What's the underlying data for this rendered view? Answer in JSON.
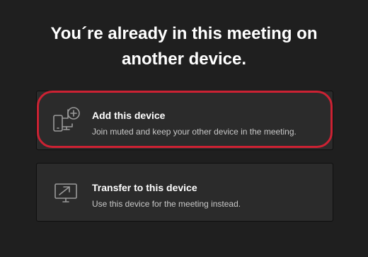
{
  "dialog": {
    "title_line1": "You´re already in this meeting on",
    "title_line2": "another device."
  },
  "options": [
    {
      "title": "Add this device",
      "description": "Join muted and keep your other device in the meeting.",
      "icon": "add-device-icon",
      "highlighted": true
    },
    {
      "title": "Transfer to this device",
      "description": "Use this device for the meeting instead.",
      "icon": "transfer-to-screen-icon",
      "highlighted": false
    }
  ],
  "colors": {
    "background": "#1f1f1f",
    "card": "#2b2b2b",
    "highlight_border": "#cc2233",
    "icon": "#9a9a9a"
  }
}
